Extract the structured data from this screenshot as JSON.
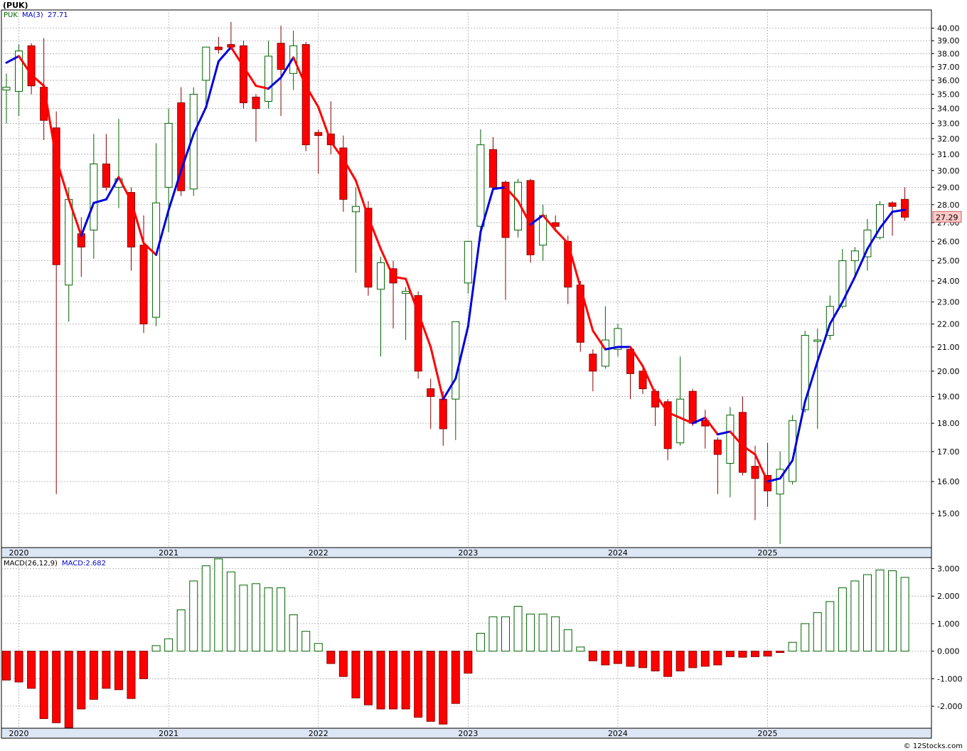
{
  "header": {
    "symbol_title": "(PUK)",
    "price_legend_symbol": "PUK",
    "price_legend_ma": "MA(3)",
    "price_legend_ma_value": "27.71",
    "macd_legend_label": "MACD(26,12,9)",
    "macd_legend_value": "MACD:2.682",
    "last_price_badge": "27.29",
    "footer_credit": "© 12Stocks.com"
  },
  "colors": {
    "up_body": "#ffffff",
    "up_border": "#006400",
    "down_body": "#ff0000",
    "down_border": "#8b0000",
    "ma_rising": "#0000dd",
    "ma_falling": "#ff0000",
    "macd_pos_fill": "#ffffff",
    "macd_pos_border": "#006400",
    "macd_neg_fill": "#ff0000",
    "grid": "#aaaaaa",
    "badge_bg": "#ffc8c8"
  },
  "chart_data": [
    {
      "type": "candlestick",
      "title": "(PUK)",
      "interval": "monthly",
      "ylim": [
        14,
        41.5
      ],
      "y_scale": "log",
      "grid": true,
      "ytick_labels": [
        "15.00",
        "16.00",
        "17.00",
        "18.00",
        "19.00",
        "20.00",
        "21.00",
        "22.00",
        "23.00",
        "24.00",
        "25.00",
        "26.00",
        "27.00",
        "28.00",
        "29.00",
        "30.00",
        "31.00",
        "32.00",
        "33.00",
        "34.00",
        "35.00",
        "36.00",
        "37.00",
        "38.00",
        "39.00",
        "40.00"
      ],
      "xtick_labels": [
        "2020",
        "2021",
        "2022",
        "2023",
        "2024",
        "2025"
      ],
      "xtick_months": [
        "2020-01",
        "2021-01",
        "2022-01",
        "2023-01",
        "2024-01",
        "2025-01"
      ],
      "candles": [
        {
          "month": "2019-12",
          "open": 35.3,
          "high": 36.5,
          "low": 33.0,
          "close": 35.5
        },
        {
          "month": "2020-01",
          "open": 35.2,
          "high": 38.7,
          "low": 33.5,
          "close": 38.2
        },
        {
          "month": "2020-02",
          "open": 38.6,
          "high": 38.8,
          "low": 35.0,
          "close": 35.6
        },
        {
          "month": "2020-03",
          "open": 35.5,
          "high": 39.2,
          "low": 31.9,
          "close": 33.2
        },
        {
          "month": "2020-04",
          "open": 32.7,
          "high": 33.8,
          "low": 15.6,
          "close": 24.8
        },
        {
          "month": "2020-05",
          "open": 23.8,
          "high": 29.0,
          "low": 22.1,
          "close": 28.3
        },
        {
          "month": "2020-06",
          "open": 26.4,
          "high": 27.3,
          "low": 24.2,
          "close": 25.7
        },
        {
          "month": "2020-07",
          "open": 26.6,
          "high": 32.3,
          "low": 25.1,
          "close": 30.4
        },
        {
          "month": "2020-08",
          "open": 30.4,
          "high": 32.3,
          "low": 28.8,
          "close": 29.0
        },
        {
          "month": "2020-09",
          "open": 29.0,
          "high": 33.3,
          "low": 27.8,
          "close": 29.5
        },
        {
          "month": "2020-10",
          "open": 28.7,
          "high": 29.0,
          "low": 24.5,
          "close": 25.7
        },
        {
          "month": "2020-11",
          "open": 25.8,
          "high": 27.4,
          "low": 21.6,
          "close": 22.0
        },
        {
          "month": "2020-12",
          "open": 22.3,
          "high": 31.7,
          "low": 21.9,
          "close": 28.1
        },
        {
          "month": "2021-01",
          "open": 29.0,
          "high": 34.0,
          "low": 26.5,
          "close": 33.0
        },
        {
          "month": "2021-02",
          "open": 34.4,
          "high": 35.5,
          "low": 28.5,
          "close": 28.8
        },
        {
          "month": "2021-03",
          "open": 28.9,
          "high": 35.5,
          "low": 28.5,
          "close": 35.0
        },
        {
          "month": "2021-04",
          "open": 36.0,
          "high": 37.0,
          "low": 34.0,
          "close": 38.5
        },
        {
          "month": "2021-05",
          "open": 38.5,
          "high": 39.3,
          "low": 38.0,
          "close": 38.3
        },
        {
          "month": "2021-06",
          "open": 38.7,
          "high": 40.5,
          "low": 38.3,
          "close": 38.5
        },
        {
          "month": "2021-07",
          "open": 38.6,
          "high": 39.0,
          "low": 34.0,
          "close": 34.4
        },
        {
          "month": "2021-08",
          "open": 34.8,
          "high": 35.0,
          "low": 31.8,
          "close": 34.0
        },
        {
          "month": "2021-09",
          "open": 34.5,
          "high": 39.0,
          "low": 34.0,
          "close": 37.8
        },
        {
          "month": "2021-10",
          "open": 38.8,
          "high": 40.2,
          "low": 33.5,
          "close": 36.8
        },
        {
          "month": "2021-11",
          "open": 36.5,
          "high": 39.8,
          "low": 35.3,
          "close": 38.6
        },
        {
          "month": "2021-12",
          "open": 38.7,
          "high": 38.9,
          "low": 31.2,
          "close": 31.6
        },
        {
          "month": "2022-01",
          "open": 32.4,
          "high": 32.6,
          "low": 29.8,
          "close": 32.2
        },
        {
          "month": "2022-02",
          "open": 32.3,
          "high": 34.5,
          "low": 31.0,
          "close": 31.6
        },
        {
          "month": "2022-03",
          "open": 31.4,
          "high": 32.2,
          "low": 27.6,
          "close": 28.3
        },
        {
          "month": "2022-04",
          "open": 27.6,
          "high": 29.0,
          "low": 24.4,
          "close": 27.9
        },
        {
          "month": "2022-05",
          "open": 27.8,
          "high": 28.2,
          "low": 23.3,
          "close": 23.7
        },
        {
          "month": "2022-06",
          "open": 23.6,
          "high": 25.2,
          "low": 20.6,
          "close": 24.9
        },
        {
          "month": "2022-07",
          "open": 24.6,
          "high": 25.0,
          "low": 21.8,
          "close": 23.9
        },
        {
          "month": "2022-08",
          "open": 23.4,
          "high": 23.7,
          "low": 21.3,
          "close": 23.5
        },
        {
          "month": "2022-09",
          "open": 23.3,
          "high": 23.5,
          "low": 19.7,
          "close": 20.0
        },
        {
          "month": "2022-10",
          "open": 19.3,
          "high": 19.7,
          "low": 17.8,
          "close": 19.0
        },
        {
          "month": "2022-11",
          "open": 18.9,
          "high": 19.2,
          "low": 17.2,
          "close": 17.8
        },
        {
          "month": "2022-12",
          "open": 18.9,
          "high": 21.2,
          "low": 17.4,
          "close": 22.1
        },
        {
          "month": "2023-01",
          "open": 23.9,
          "high": 26.0,
          "low": 23.4,
          "close": 26.0
        },
        {
          "month": "2023-02",
          "open": 26.8,
          "high": 32.6,
          "low": 26.0,
          "close": 31.6
        },
        {
          "month": "2023-03",
          "open": 31.3,
          "high": 32.1,
          "low": 28.8,
          "close": 29.0
        },
        {
          "month": "2023-04",
          "open": 29.3,
          "high": 29.4,
          "low": 23.1,
          "close": 26.2
        },
        {
          "month": "2023-05",
          "open": 26.6,
          "high": 29.5,
          "low": 26.2,
          "close": 29.3
        },
        {
          "month": "2023-06",
          "open": 29.4,
          "high": 29.5,
          "low": 24.9,
          "close": 25.3
        },
        {
          "month": "2023-07",
          "open": 25.8,
          "high": 28.0,
          "low": 25.0,
          "close": 27.4
        },
        {
          "month": "2023-08",
          "open": 27.0,
          "high": 27.4,
          "low": 26.5,
          "close": 26.8
        },
        {
          "month": "2023-09",
          "open": 26.0,
          "high": 26.3,
          "low": 22.9,
          "close": 23.7
        },
        {
          "month": "2023-10",
          "open": 23.8,
          "high": 24.0,
          "low": 20.8,
          "close": 21.2
        },
        {
          "month": "2023-11",
          "open": 20.7,
          "high": 20.9,
          "low": 19.2,
          "close": 20.0
        },
        {
          "month": "2023-12",
          "open": 20.2,
          "high": 22.8,
          "low": 20.1,
          "close": 21.3
        },
        {
          "month": "2024-01",
          "open": 20.9,
          "high": 22.0,
          "low": 20.6,
          "close": 21.8
        },
        {
          "month": "2024-02",
          "open": 20.9,
          "high": 21.0,
          "low": 18.9,
          "close": 19.9
        },
        {
          "month": "2024-03",
          "open": 20.0,
          "high": 20.2,
          "low": 19.1,
          "close": 19.3
        },
        {
          "month": "2024-04",
          "open": 19.2,
          "high": 19.3,
          "low": 17.9,
          "close": 18.6
        },
        {
          "month": "2024-05",
          "open": 18.8,
          "high": 18.9,
          "low": 16.7,
          "close": 17.1
        },
        {
          "month": "2024-06",
          "open": 17.3,
          "high": 20.6,
          "low": 17.2,
          "close": 18.9
        },
        {
          "month": "2024-07",
          "open": 19.2,
          "high": 19.3,
          "low": 17.9,
          "close": 18.0
        },
        {
          "month": "2024-08",
          "open": 18.1,
          "high": 18.5,
          "low": 17.1,
          "close": 17.9
        },
        {
          "month": "2024-09",
          "open": 17.4,
          "high": 17.5,
          "low": 15.6,
          "close": 16.9
        },
        {
          "month": "2024-10",
          "open": 16.6,
          "high": 18.6,
          "low": 15.5,
          "close": 18.3
        },
        {
          "month": "2024-11",
          "open": 18.4,
          "high": 19.0,
          "low": 16.2,
          "close": 16.3
        },
        {
          "month": "2024-12",
          "open": 16.5,
          "high": 17.2,
          "low": 14.8,
          "close": 16.1
        },
        {
          "month": "2025-01",
          "open": 16.2,
          "high": 17.3,
          "low": 15.2,
          "close": 15.7
        },
        {
          "month": "2025-02",
          "open": 15.6,
          "high": 17.0,
          "low": 14.1,
          "close": 16.4
        },
        {
          "month": "2025-03",
          "open": 16.0,
          "high": 18.3,
          "low": 15.9,
          "close": 18.1
        },
        {
          "month": "2025-04",
          "open": 18.5,
          "high": 21.7,
          "low": 18.4,
          "close": 21.5
        },
        {
          "month": "2025-05",
          "open": 21.3,
          "high": 21.8,
          "low": 17.8,
          "close": 21.3
        },
        {
          "month": "2025-06",
          "open": 21.5,
          "high": 23.3,
          "low": 21.3,
          "close": 22.8
        },
        {
          "month": "2025-07",
          "open": 22.8,
          "high": 25.6,
          "low": 22.7,
          "close": 25.0
        },
        {
          "month": "2025-08",
          "open": 25.0,
          "high": 25.7,
          "low": 24.3,
          "close": 25.5
        },
        {
          "month": "2025-09",
          "open": 25.2,
          "high": 27.2,
          "low": 24.5,
          "close": 26.6
        },
        {
          "month": "2025-10",
          "open": 26.2,
          "high": 28.2,
          "low": 26.1,
          "close": 28.0
        },
        {
          "month": "2025-11",
          "open": 28.1,
          "high": 28.2,
          "low": 26.3,
          "close": 27.9
        },
        {
          "month": "2025-12",
          "open": 28.3,
          "high": 29.0,
          "low": 27.1,
          "close": 27.3
        }
      ],
      "ma": {
        "name": "MA(3)",
        "values": [
          37.3,
          37.8,
          36.4,
          35.6,
          30.7,
          28.3,
          26.3,
          28.1,
          28.3,
          29.6,
          28.2,
          25.9,
          25.3,
          27.7,
          30.0,
          32.3,
          34.1,
          37.4,
          38.5,
          37.0,
          35.6,
          35.4,
          36.2,
          37.7,
          35.6,
          34.1,
          31.8,
          30.7,
          29.4,
          27.3,
          25.6,
          24.2,
          24.1,
          22.5,
          21.0,
          18.9,
          19.7,
          21.9,
          26.5,
          28.9,
          29.0,
          28.2,
          26.9,
          27.4,
          26.6,
          25.9,
          23.7,
          21.7,
          20.9,
          21.0,
          21.0,
          20.2,
          19.1,
          18.4,
          18.2,
          18.0,
          18.2,
          17.6,
          17.7,
          17.2,
          16.9,
          16.0,
          16.1,
          16.7,
          18.8,
          20.4,
          22.0,
          23.0,
          24.2,
          25.6,
          26.7,
          27.6,
          27.71
        ]
      }
    },
    {
      "type": "bar",
      "title": "MACD(26,12,9)",
      "ylim": [
        -2.8,
        3.4
      ],
      "grid": true,
      "ytick_labels": [
        "-2.000",
        "-1.000",
        "0.000",
        "1.000",
        "2.000",
        "3.000"
      ],
      "xtick_labels": [
        "2020",
        "2021",
        "2022",
        "2023",
        "2024",
        "2025"
      ],
      "series": [
        {
          "name": "MACD:2.682",
          "values": [
            -1.35,
            -1.05,
            -1.12,
            -1.35,
            -2.45,
            -2.6,
            -2.78,
            -2.1,
            -1.75,
            -1.35,
            -1.4,
            -1.72,
            -1.0,
            0.2,
            0.45,
            1.5,
            2.55,
            3.1,
            3.35,
            2.88,
            2.4,
            2.45,
            2.3,
            2.3,
            1.32,
            0.72,
            0.28,
            -0.45,
            -0.92,
            -1.7,
            -1.95,
            -2.1,
            -2.1,
            -2.1,
            -2.4,
            -2.55,
            -2.65,
            -1.9,
            -0.8,
            0.65,
            1.25,
            1.25,
            1.63,
            1.35,
            1.35,
            1.25,
            0.78,
            0.15,
            -0.35,
            -0.5,
            -0.45,
            -0.55,
            -0.6,
            -0.72,
            -0.92,
            -0.72,
            -0.6,
            -0.55,
            -0.5,
            -0.2,
            -0.22,
            -0.2,
            -0.18,
            -0.05,
            0.32,
            1.0,
            1.4,
            1.8,
            2.3,
            2.55,
            2.78,
            2.95,
            2.92,
            2.68
          ]
        }
      ]
    }
  ]
}
